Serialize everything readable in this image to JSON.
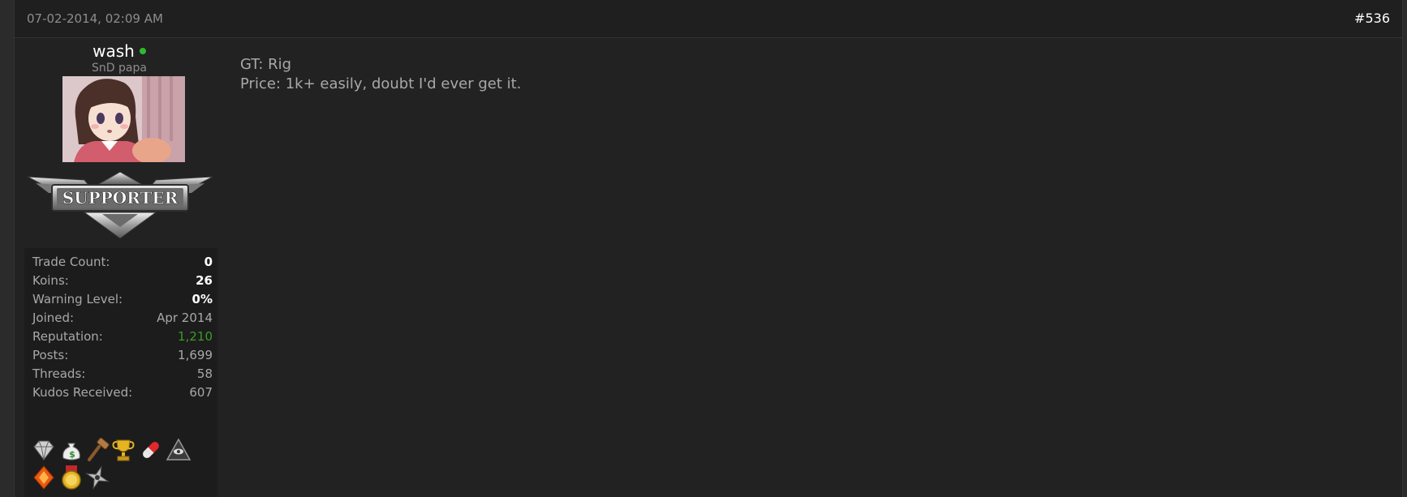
{
  "post": {
    "date": "07-02-2014, 02:09 AM",
    "number": "#536"
  },
  "user": {
    "name": "wash",
    "title": "SnD papa",
    "online": true,
    "badge_text": "SUPPORTER"
  },
  "stats": [
    {
      "label": "Trade Count:",
      "value": "0"
    },
    {
      "label": "Koins:",
      "value": "26"
    },
    {
      "label": "Warning Level:",
      "value": "0%"
    },
    {
      "label": "Joined:",
      "value": "Apr 2014"
    },
    {
      "label": "Reputation:",
      "value": "1,210"
    },
    {
      "label": "Posts:",
      "value": "1,699"
    },
    {
      "label": "Threads:",
      "value": "58"
    },
    {
      "label": "Kudos Received:",
      "value": "607"
    }
  ],
  "awards": [
    "diamond-award-icon",
    "money-bag-award-icon",
    "gavel-award-icon",
    "trophy-award-icon",
    "pill-award-icon",
    "eye-pyramid-award-icon",
    "flame-gem-award-icon",
    "gold-medal-award-icon",
    "shuriken-award-icon"
  ],
  "message": {
    "lines": [
      "GT: Rig",
      "Price: 1k+ easily, doubt I'd ever get it."
    ]
  },
  "colors": {
    "background": "#222222",
    "header": "#1f1f1f",
    "text_muted": "#a8a8a8",
    "reputation": "#3c9a29",
    "online": "#2dbb2d"
  }
}
